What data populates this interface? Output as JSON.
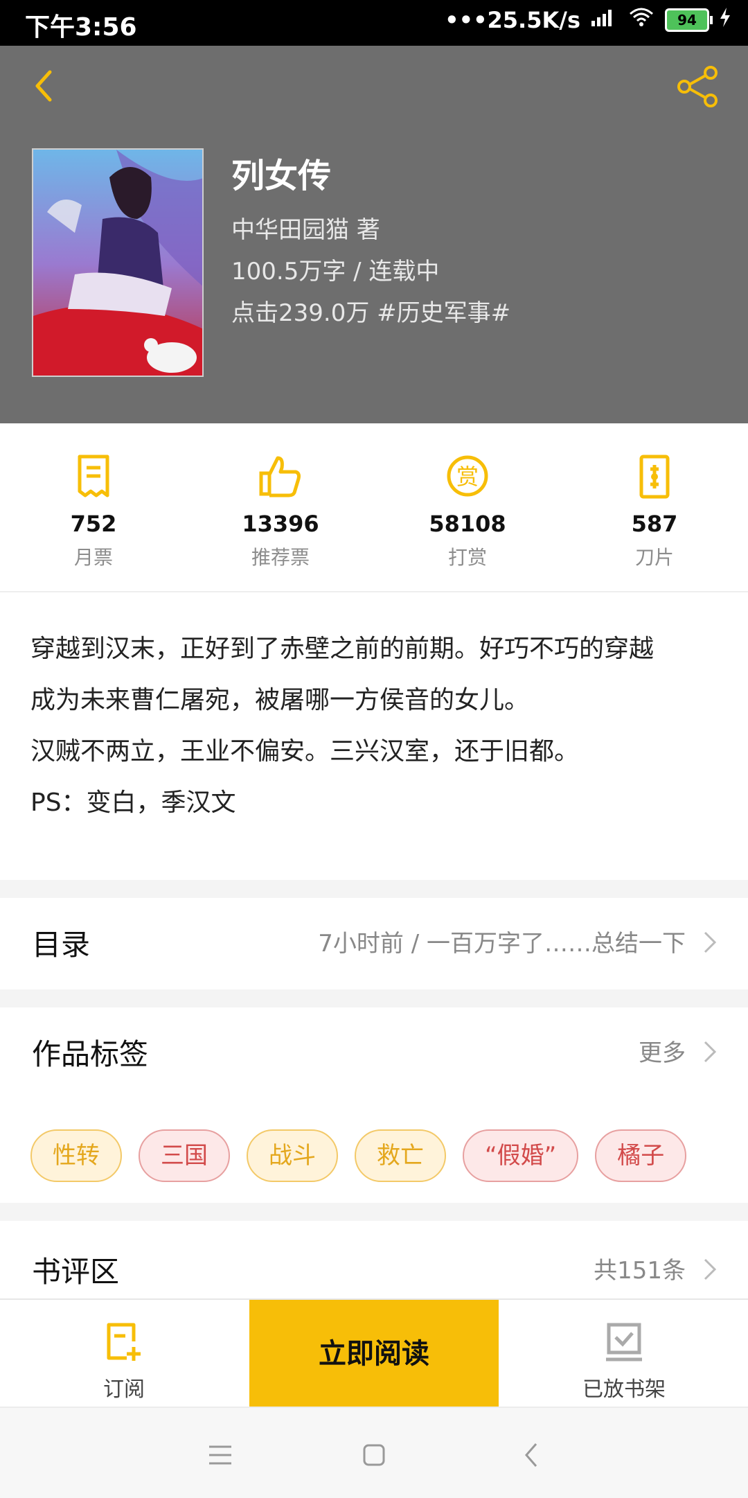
{
  "status_bar": {
    "time": "下午3:56",
    "network_speed": "•••25.5K/s",
    "battery": "94"
  },
  "header": {
    "title": "列女传",
    "author": "中华田园猫  著",
    "words_status": "100.5万字 / 连载中",
    "clicks_genre": "点击239.0万  #历史军事#",
    "accent_color": "#f7be08"
  },
  "stats": [
    {
      "value": "752",
      "label": "月票",
      "icon": "ticket-icon"
    },
    {
      "value": "13396",
      "label": "推荐票",
      "icon": "thumbs-up-icon"
    },
    {
      "value": "58108",
      "label": "打赏",
      "icon": "reward-coin-icon"
    },
    {
      "value": "587",
      "label": "刀片",
      "icon": "blade-icon"
    }
  ],
  "description": {
    "line1": "穿越到汉末，正好到了赤壁之前的前期。好巧不巧的穿越",
    "line2": "成为未来曹仁屠宛，被屠哪一方侯音的女儿。",
    "line3": "汉贼不两立，王业不偏安。三兴汉室，还于旧都。",
    "line4": "PS：变白，季汉文"
  },
  "catalog": {
    "title": "目录",
    "latest": "7小时前 / 一百万字了……总结一下"
  },
  "tags_section": {
    "title": "作品标签",
    "more": "更多",
    "tags": [
      {
        "label": "性转",
        "color": "yellow"
      },
      {
        "label": "三国",
        "color": "red"
      },
      {
        "label": "战斗",
        "color": "yellow"
      },
      {
        "label": "救亡",
        "color": "yellow"
      },
      {
        "label": "“假婚”",
        "color": "red"
      },
      {
        "label": "橘子",
        "color": "red"
      }
    ]
  },
  "reviews": {
    "title": "书评区",
    "count": "共151条"
  },
  "bottom_bar": {
    "subscribe": "订阅",
    "read_now": "立即阅读",
    "shelf": "已放书架"
  }
}
